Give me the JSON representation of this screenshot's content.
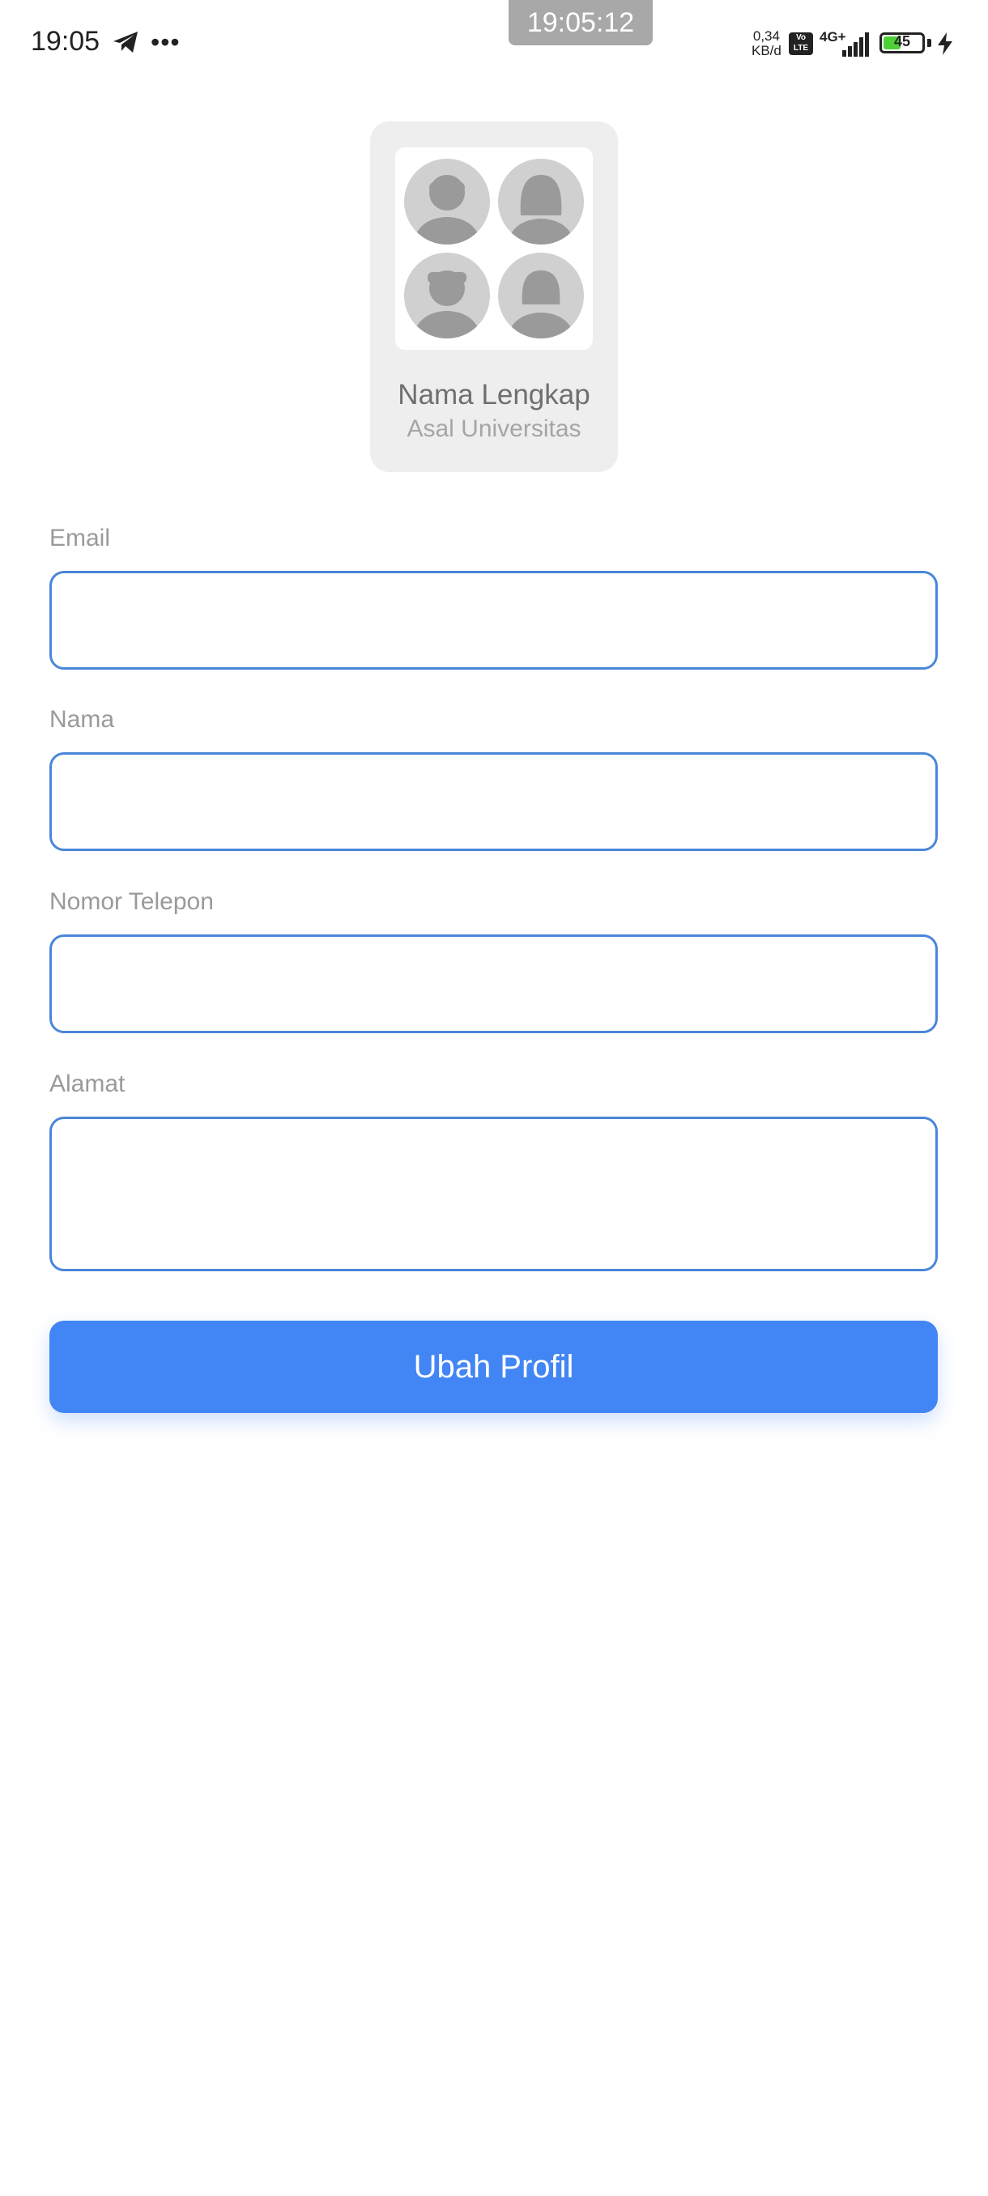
{
  "status_bar": {
    "time": "19:05",
    "more": "•••",
    "recording_clock": "19:05:12",
    "net_speed_value": "0,34",
    "net_speed_unit": "KB/d",
    "volte": "Vo LTE",
    "network": "4G+",
    "battery_level": "45",
    "battery_fraction": 0.45
  },
  "profile_card": {
    "full_name": "Nama Lengkap",
    "university": "Asal Universitas",
    "avatar_icon": "placeholder-avatars-icon"
  },
  "form": {
    "email_label": "Email",
    "email_value": "",
    "name_label": "Nama",
    "name_value": "",
    "phone_label": "Nomor Telepon",
    "phone_value": "",
    "address_label": "Alamat",
    "address_value": "",
    "submit_label": "Ubah Profil"
  },
  "colors": {
    "accent": "#4285f4",
    "input_border": "#4a86d9",
    "label": "#9a9a9a",
    "card_bg": "#eeeeee"
  }
}
